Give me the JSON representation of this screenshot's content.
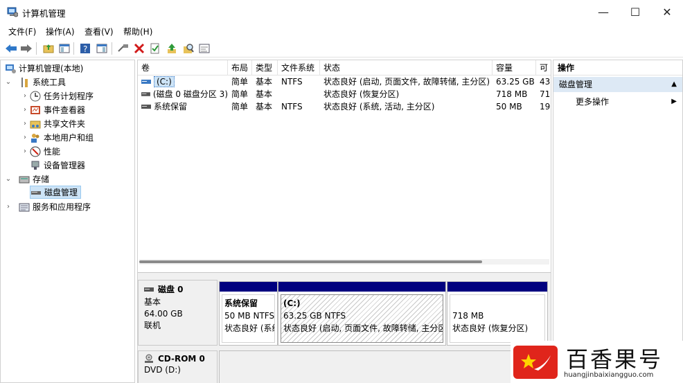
{
  "window": {
    "title": "计算机管理",
    "minimize_glyph": "—",
    "maximize_glyph": "☐",
    "close_glyph": "✕"
  },
  "menu": [
    "文件(F)",
    "操作(A)",
    "查看(V)",
    "帮助(H)"
  ],
  "toolbar": {
    "icons": [
      "back-arrow-icon",
      "forward-arrow-icon",
      "up-folder-icon",
      "show-hide-tree-icon",
      "help-icon",
      "properties-view-icon",
      "connect-icon",
      "delete-icon",
      "check-properties-icon",
      "up-arrow-icon",
      "search-icon",
      "console-icon"
    ],
    "delete_color": "#d11a1a"
  },
  "tree": {
    "root": "计算机管理(本地)",
    "system_tools": "系统工具",
    "task_scheduler": "任务计划程序",
    "event_viewer": "事件查看器",
    "shared_folders": "共享文件夹",
    "local_users": "本地用户和组",
    "performance": "性能",
    "device_manager": "设备管理器",
    "storage": "存储",
    "disk_management": "磁盘管理",
    "services_apps": "服务和应用程序"
  },
  "volume_table": {
    "columns": [
      "卷",
      "布局",
      "类型",
      "文件系统",
      "状态",
      "容量",
      "可"
    ],
    "rows": [
      {
        "volume": "(C:)",
        "layout": "简单",
        "type": "基本",
        "fs": "NTFS",
        "status": "状态良好 (启动, 页面文件, 故障转储, 主分区)",
        "capacity": "63.25 GB",
        "free": "43"
      },
      {
        "volume": "(磁盘 0 磁盘分区 3)",
        "layout": "简单",
        "type": "基本",
        "fs": "",
        "status": "状态良好 (恢复分区)",
        "capacity": "718 MB",
        "free": "71"
      },
      {
        "volume": "系统保留",
        "layout": "简单",
        "type": "基本",
        "fs": "NTFS",
        "status": "状态良好 (系统, 活动, 主分区)",
        "capacity": "50 MB",
        "free": "19"
      }
    ]
  },
  "disks": [
    {
      "name": "磁盘 0",
      "type": "基本",
      "size": "64.00 GB",
      "state": "联机",
      "partitions": [
        {
          "name": "系统保留",
          "size_fs": "50 MB NTFS",
          "status": "状态良好 (系统"
        },
        {
          "name": "(C:)",
          "size_fs": "63.25 GB NTFS",
          "status": "状态良好 (启动, 页面文件, 故障转储, 主分区"
        },
        {
          "name": "",
          "size_fs": "718 MB",
          "status": "状态良好 (恢复分区)"
        }
      ]
    },
    {
      "name": "CD-ROM 0",
      "type": "DVD (D:)"
    }
  ],
  "actions": {
    "header": "操作",
    "section": "磁盘管理",
    "more": "更多操作"
  },
  "watermark": {
    "text": "百香果号",
    "url": "huangjinbaixiangguo.com",
    "logo_color": "#e0251b"
  },
  "colors": {
    "partition_bar": "#00007f",
    "selection": "#cde4f7",
    "action_section_bg": "#dde9f5"
  }
}
